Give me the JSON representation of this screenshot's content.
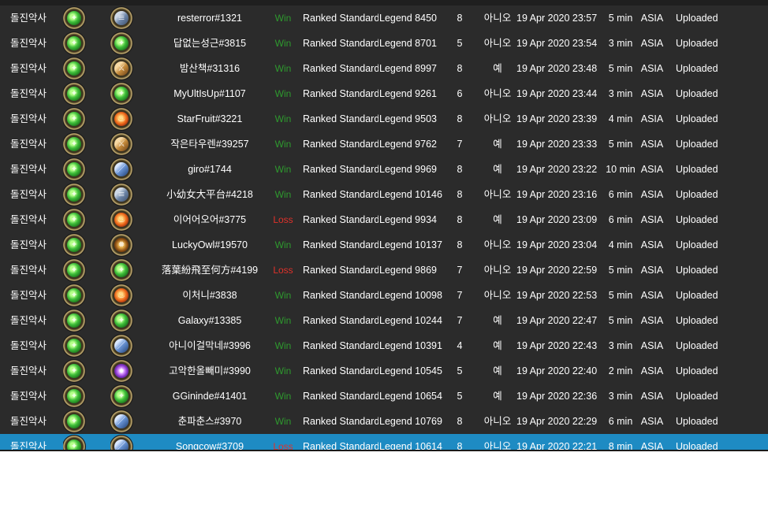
{
  "rows": [
    {
      "hero": "돌진악사",
      "hero_icon": "green-orb-icon",
      "opponent_icon": "scroll-icon",
      "player": "resterror#1321",
      "result": "Win",
      "mode": "Ranked Standard",
      "rank": "Legend 8450",
      "turns": "8",
      "coin": "아니오",
      "date": "19 Apr 2020 23:57",
      "duration": "5 min",
      "region": "ASIA",
      "status": "Uploaded"
    },
    {
      "hero": "돌진악사",
      "hero_icon": "green-orb-icon",
      "opponent_icon": "green-orb-icon",
      "player": "답없는성근#3815",
      "result": "Win",
      "mode": "Ranked Standard",
      "rank": "Legend 8701",
      "turns": "5",
      "coin": "아니오",
      "date": "19 Apr 2020 23:54",
      "duration": "3 min",
      "region": "ASIA",
      "status": "Uploaded"
    },
    {
      "hero": "돌진악사",
      "hero_icon": "green-orb-icon",
      "opponent_icon": "sword-icon",
      "player": "밤산책#31316",
      "result": "Win",
      "mode": "Ranked Standard",
      "rank": "Legend 8997",
      "turns": "8",
      "coin": "예",
      "date": "19 Apr 2020 23:48",
      "duration": "5 min",
      "region": "ASIA",
      "status": "Uploaded"
    },
    {
      "hero": "돌진악사",
      "hero_icon": "green-orb-icon",
      "opponent_icon": "green-orb-icon",
      "player": "MyUltIsUp#1107",
      "result": "Win",
      "mode": "Ranked Standard",
      "rank": "Legend 9261",
      "turns": "6",
      "coin": "아니오",
      "date": "19 Apr 2020 23:44",
      "duration": "3 min",
      "region": "ASIA",
      "status": "Uploaded"
    },
    {
      "hero": "돌진악사",
      "hero_icon": "green-orb-icon",
      "opponent_icon": "fire-icon",
      "player": "StarFruit#3221",
      "result": "Win",
      "mode": "Ranked Standard",
      "rank": "Legend 9503",
      "turns": "8",
      "coin": "아니오",
      "date": "19 Apr 2020 23:39",
      "duration": "4 min",
      "region": "ASIA",
      "status": "Uploaded"
    },
    {
      "hero": "돌진악사",
      "hero_icon": "green-orb-icon",
      "opponent_icon": "sword-icon",
      "player": "작은타우렌#39257",
      "result": "Win",
      "mode": "Ranked Standard",
      "rank": "Legend 9762",
      "turns": "7",
      "coin": "예",
      "date": "19 Apr 2020 23:33",
      "duration": "5 min",
      "region": "ASIA",
      "status": "Uploaded"
    },
    {
      "hero": "돌진악사",
      "hero_icon": "green-orb-icon",
      "opponent_icon": "blade-icon",
      "player": "giro#1744",
      "result": "Win",
      "mode": "Ranked Standard",
      "rank": "Legend 9969",
      "turns": "8",
      "coin": "예",
      "date": "19 Apr 2020 23:22",
      "duration": "10 min",
      "region": "ASIA",
      "status": "Uploaded"
    },
    {
      "hero": "돌진악사",
      "hero_icon": "green-orb-icon",
      "opponent_icon": "scroll-icon",
      "player": "小幼女大平台#4218",
      "result": "Win",
      "mode": "Ranked Standard",
      "rank": "Legend 10146",
      "turns": "8",
      "coin": "아니오",
      "date": "19 Apr 2020 23:16",
      "duration": "6 min",
      "region": "ASIA",
      "status": "Uploaded"
    },
    {
      "hero": "돌진악사",
      "hero_icon": "green-orb-icon",
      "opponent_icon": "fire-icon",
      "player": "이어어오어#3775",
      "result": "Loss",
      "mode": "Ranked Standard",
      "rank": "Legend 9934",
      "turns": "8",
      "coin": "예",
      "date": "19 Apr 2020 23:09",
      "duration": "6 min",
      "region": "ASIA",
      "status": "Uploaded"
    },
    {
      "hero": "돌진악사",
      "hero_icon": "green-orb-icon",
      "opponent_icon": "beast-icon",
      "player": "LuckyOwl#19570",
      "result": "Win",
      "mode": "Ranked Standard",
      "rank": "Legend 10137",
      "turns": "8",
      "coin": "아니오",
      "date": "19 Apr 2020 23:04",
      "duration": "4 min",
      "region": "ASIA",
      "status": "Uploaded"
    },
    {
      "hero": "돌진악사",
      "hero_icon": "green-orb-icon",
      "opponent_icon": "green-orb-icon",
      "player": "落葉紛飛至何方#4199",
      "result": "Loss",
      "mode": "Ranked Standard",
      "rank": "Legend 9869",
      "turns": "7",
      "coin": "아니오",
      "date": "19 Apr 2020 22:59",
      "duration": "5 min",
      "region": "ASIA",
      "status": "Uploaded"
    },
    {
      "hero": "돌진악사",
      "hero_icon": "green-orb-icon",
      "opponent_icon": "fire-icon",
      "player": "이처니#3838",
      "result": "Win",
      "mode": "Ranked Standard",
      "rank": "Legend 10098",
      "turns": "7",
      "coin": "아니오",
      "date": "19 Apr 2020 22:53",
      "duration": "5 min",
      "region": "ASIA",
      "status": "Uploaded"
    },
    {
      "hero": "돌진악사",
      "hero_icon": "green-orb-icon",
      "opponent_icon": "green-orb-icon",
      "player": "Galaxy#13385",
      "result": "Win",
      "mode": "Ranked Standard",
      "rank": "Legend 10244",
      "turns": "7",
      "coin": "예",
      "date": "19 Apr 2020 22:47",
      "duration": "5 min",
      "region": "ASIA",
      "status": "Uploaded"
    },
    {
      "hero": "돌진악사",
      "hero_icon": "green-orb-icon",
      "opponent_icon": "blade-icon",
      "player": "아니이걸막네#3996",
      "result": "Win",
      "mode": "Ranked Standard",
      "rank": "Legend 10391",
      "turns": "4",
      "coin": "예",
      "date": "19 Apr 2020 22:43",
      "duration": "3 min",
      "region": "ASIA",
      "status": "Uploaded"
    },
    {
      "hero": "돌진악사",
      "hero_icon": "green-orb-icon",
      "opponent_icon": "arcane-icon",
      "player": "고악한올빼미#3990",
      "result": "Win",
      "mode": "Ranked Standard",
      "rank": "Legend 10545",
      "turns": "5",
      "coin": "예",
      "date": "19 Apr 2020 22:40",
      "duration": "2 min",
      "region": "ASIA",
      "status": "Uploaded"
    },
    {
      "hero": "돌진악사",
      "hero_icon": "green-orb-icon",
      "opponent_icon": "green-orb-icon",
      "player": "GGininde#41401",
      "result": "Win",
      "mode": "Ranked Standard",
      "rank": "Legend 10654",
      "turns": "5",
      "coin": "예",
      "date": "19 Apr 2020 22:36",
      "duration": "3 min",
      "region": "ASIA",
      "status": "Uploaded"
    },
    {
      "hero": "돌진악사",
      "hero_icon": "green-orb-icon",
      "opponent_icon": "blade-icon",
      "player": "춘파춘스#3970",
      "result": "Win",
      "mode": "Ranked Standard",
      "rank": "Legend 10769",
      "turns": "8",
      "coin": "아니오",
      "date": "19 Apr 2020 22:29",
      "duration": "6 min",
      "region": "ASIA",
      "status": "Uploaded"
    },
    {
      "hero": "돌진악사",
      "hero_icon": "green-orb-icon",
      "opponent_icon": "blade-icon",
      "player": "Songcow#3709",
      "result": "Loss",
      "mode": "Ranked Standard",
      "rank": "Legend 10614",
      "turns": "8",
      "coin": "아니오",
      "date": "19 Apr 2020 22:21",
      "duration": "8 min",
      "region": "ASIA",
      "status": "Uploaded",
      "selected": true
    }
  ]
}
